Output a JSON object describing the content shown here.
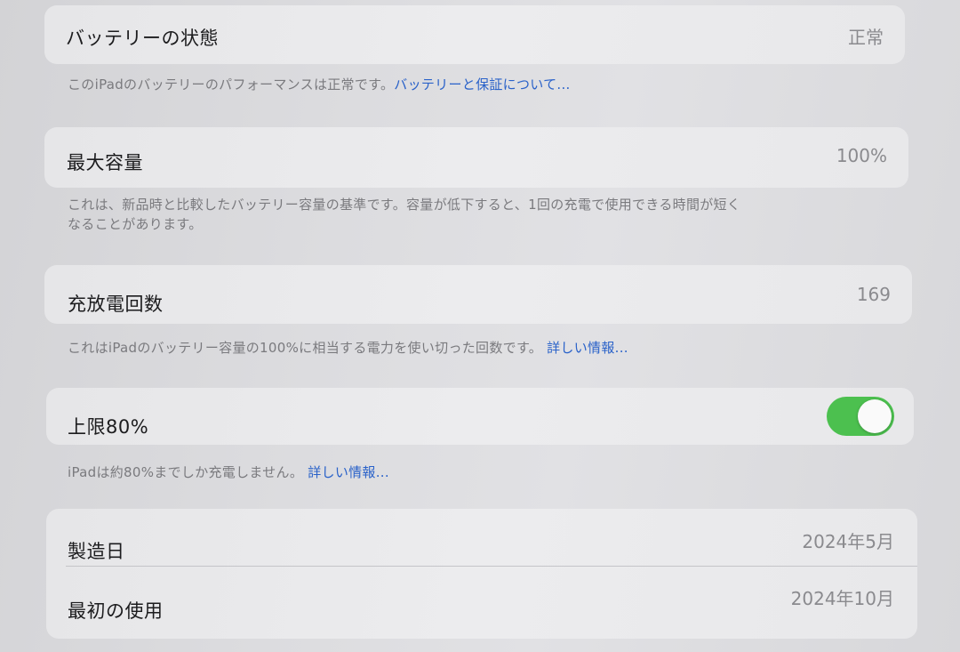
{
  "battery_health": {
    "label": "バッテリーの状態",
    "value": "正常",
    "footnote_text": "このiPadのバッテリーのパフォーマンスは正常です。",
    "footnote_link": "バッテリーと保証について..."
  },
  "max_capacity": {
    "label": "最大容量",
    "value": "100%",
    "footnote_line1": "これは、新品時と比較したバッテリー容量の基準です。容量が低下すると、1回の充電で使用できる時間が短く",
    "footnote_line2": "なることがあります。"
  },
  "cycle_count": {
    "label": "充放電回数",
    "value": "169",
    "footnote_text": "これはiPadのバッテリー容量の100%に相当する電力を使い切った回数です。",
    "footnote_link": "詳しい情報..."
  },
  "limit_80": {
    "label": "上限80%",
    "toggle_on": true,
    "toggle_color": "#4cc04f",
    "footnote_text": "iPadは約80%までしか充電しません。",
    "footnote_link": "詳しい情報..."
  },
  "dates": {
    "manufacture_label": "製造日",
    "manufacture_value": "2024年5月",
    "first_use_label": "最初の使用",
    "first_use_value": "2024年10月"
  }
}
